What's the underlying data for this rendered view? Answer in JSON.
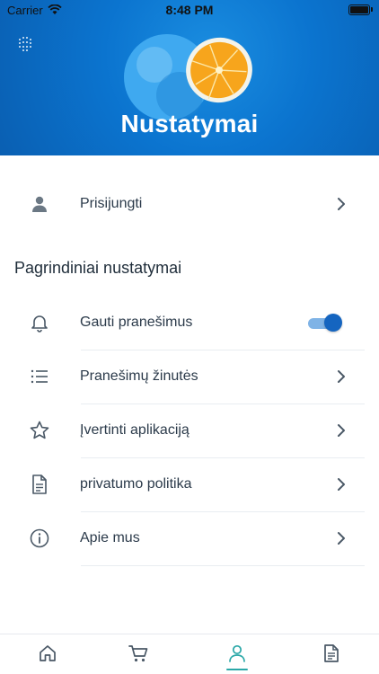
{
  "status_bar": {
    "carrier": "Carrier",
    "time": "8:48 PM"
  },
  "header": {
    "title": "Nustatymai"
  },
  "login_row": {
    "label": "Prisijungti",
    "icon": "person-icon"
  },
  "section": {
    "title": "Pagrindiniai nustatymai"
  },
  "settings": {
    "notifications": {
      "label": "Gauti pranešimus",
      "icon": "bell-icon",
      "enabled": true
    },
    "messages": {
      "label": "Pranešimų žinutės",
      "icon": "list-icon"
    },
    "rate": {
      "label": "Įvertinti aplikaciją",
      "icon": "star-icon"
    },
    "privacy": {
      "label": "privatumo politika",
      "icon": "document-icon"
    },
    "about": {
      "label": "Apie mus",
      "icon": "info-icon"
    }
  },
  "tabbar": {
    "tabs": [
      {
        "name": "home",
        "icon": "home-icon"
      },
      {
        "name": "cart",
        "icon": "cart-icon"
      },
      {
        "name": "profile",
        "icon": "profile-icon",
        "active": true
      },
      {
        "name": "documents",
        "icon": "document-icon"
      }
    ]
  },
  "colors": {
    "accent": "#0b74cf",
    "toggle_on": "#1565c0",
    "tab_active": "#2ba8a8",
    "icon": "#4a5866"
  }
}
